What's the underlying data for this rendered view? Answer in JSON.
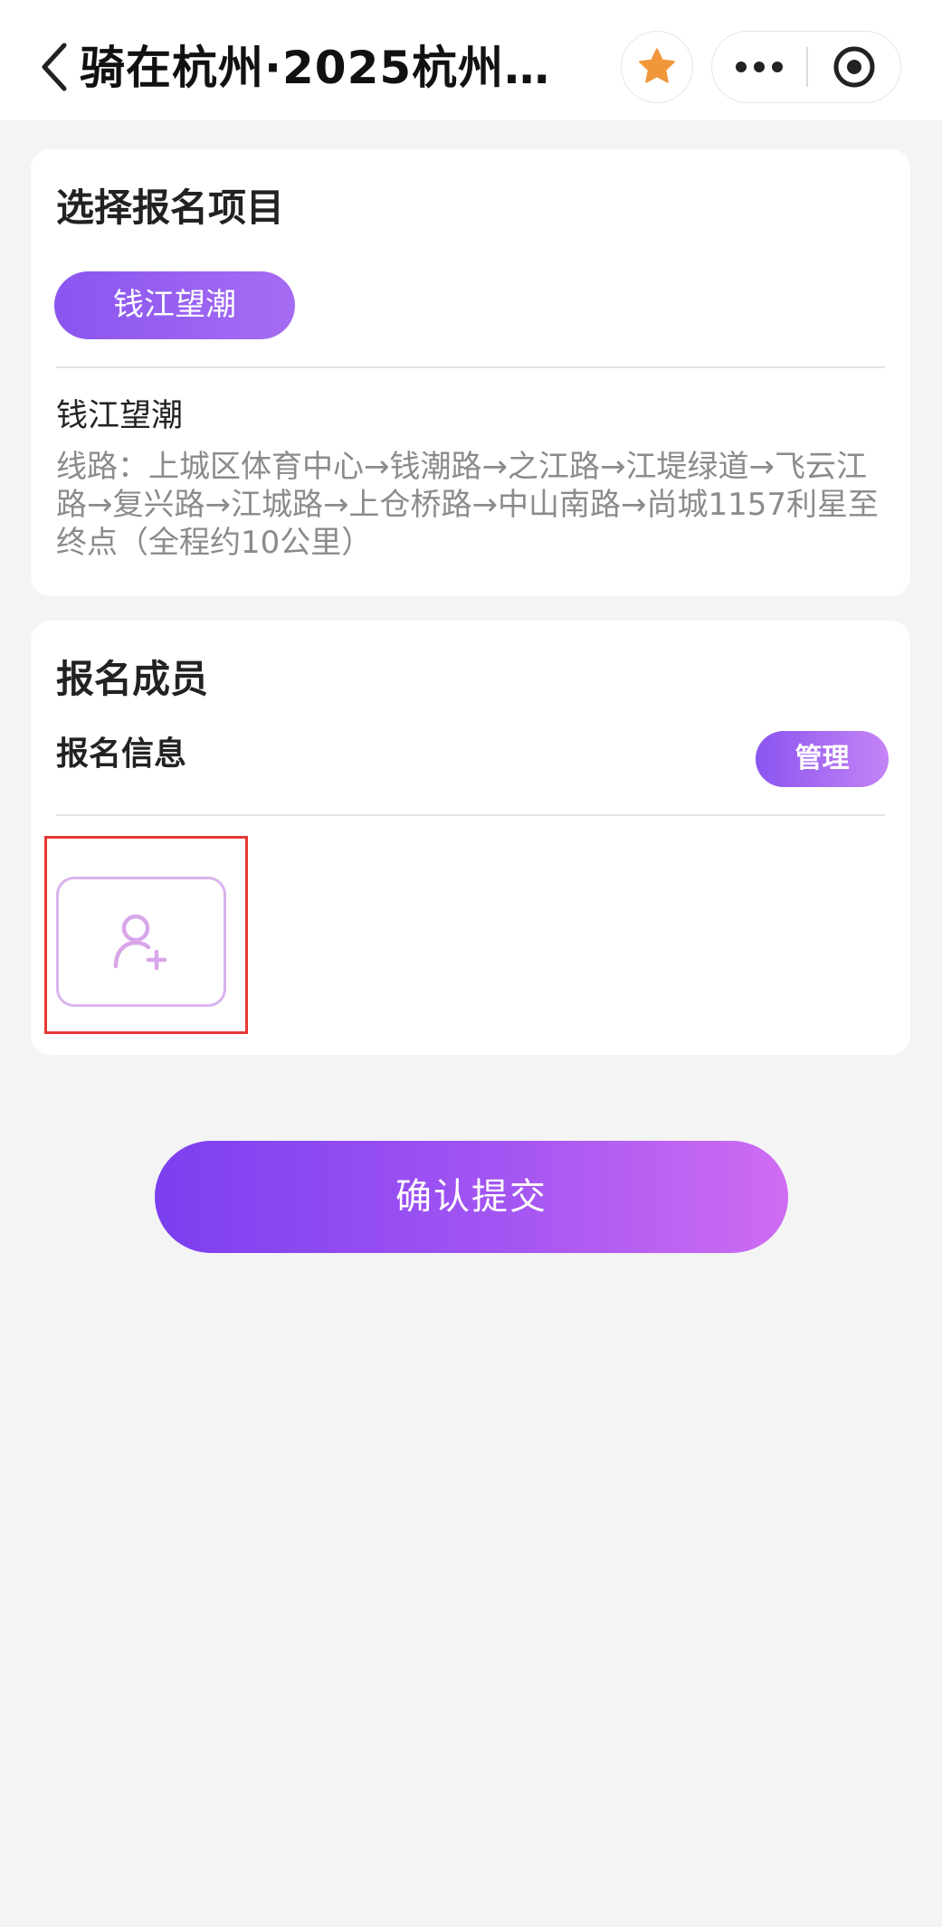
{
  "navbar": {
    "title": "骑在杭州·2025杭州…",
    "back_icon": "chevron-left-icon",
    "favorite_icon": "star-icon",
    "more_icon": "more-dots-icon",
    "target_icon": "target-icon",
    "favorite_color": "#f0973a"
  },
  "project_section": {
    "heading": "选择报名项目",
    "selected_project": "钱江望潮",
    "route_name": "钱江望潮",
    "route_description": "线路：上城区体育中心→钱潮路→之江路→江堤绿道→飞云江路→复兴路→江城路→上仓桥路→中山南路→尚城1157利星至终点（全程约10公里）"
  },
  "members_section": {
    "heading": "报名成员",
    "info_label": "报名信息",
    "manage_label": "管理",
    "add_member_icon": "add-user-icon"
  },
  "footer": {
    "submit_label": "确认提交"
  },
  "colors": {
    "accent": "#8a55f0",
    "accent_end": "#cf6cf2",
    "add_member_border": "#d9b3ee",
    "highlight": "#e53935"
  }
}
